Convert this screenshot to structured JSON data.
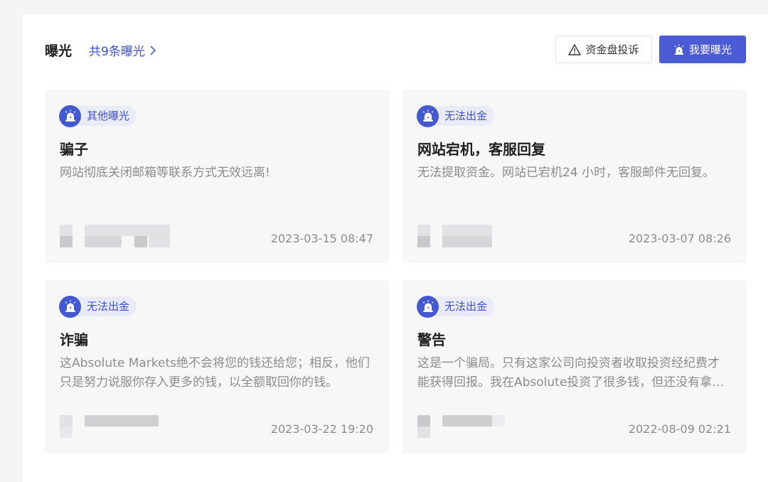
{
  "header": {
    "title": "曝光",
    "count_link": "共9条曝光",
    "complain_button": "资金盘投诉",
    "expose_button": "我要曝光"
  },
  "cards": [
    {
      "tag": "其他曝光",
      "title": "骗子",
      "desc": "网站彻底关闭邮箱等联系方式无效远离!",
      "date": "2023-03-15 08:47"
    },
    {
      "tag": "无法出金",
      "title": "网站宕机，客服回复",
      "desc": "无法提取资金。网站已宕机24 小时，客服邮件无回复。",
      "date": "2023-03-07 08:26"
    },
    {
      "tag": "无法出金",
      "title": "诈骗",
      "desc": "这Absolute Markets绝不会将您的钱还给您；相反，他们只是努力说服你存入更多的钱，以全额取回你的钱。",
      "date": "2023-03-22 19:20"
    },
    {
      "tag": "无法出金",
      "title": "警告",
      "desc": "这是一个骗局。只有这家公司向投资者收取投资经纪费才能获得回报。我在Absolute投资了很多钱，但还没有拿回来。",
      "date": "2022-08-09 02:21"
    }
  ],
  "colors": {
    "accent": "#4a5bd3",
    "tag_bg": "#e9ecf8",
    "card_bg": "#f7f7f8",
    "muted_text": "#8c8c8c"
  },
  "icons": {
    "chevron": "chevron-right-icon",
    "warning": "warning-triangle-icon",
    "alarm": "alarm-siren-icon"
  }
}
